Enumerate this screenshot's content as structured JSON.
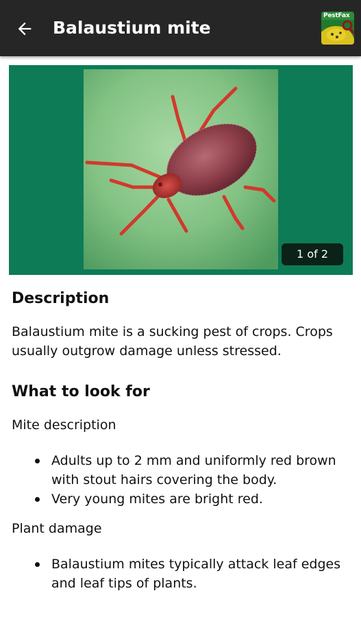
{
  "header": {
    "title": "Balaustium mite",
    "back_icon": "arrow-left-icon",
    "logo_text": "PestFax",
    "background": "#262626"
  },
  "gallery": {
    "counter": "1 of 2",
    "background": "#0d7b56",
    "image": "red-mite-on-green-leaf"
  },
  "description": {
    "heading": "Description",
    "text": "Balaustium mite is a sucking pest of crops. Crops usually outgrow damage unless stressed."
  },
  "look_for": {
    "heading": "What to look for",
    "mite_description": {
      "label": "Mite description",
      "bullets": [
        "Adults up to 2 mm and uniformly red brown with stout hairs covering the body.",
        "Very young mites are bright red."
      ]
    },
    "plant_damage": {
      "label": "Plant damage",
      "bullets": [
        "Balaustium mites typically attack leaf edges and leaf tips of plants."
      ]
    }
  }
}
